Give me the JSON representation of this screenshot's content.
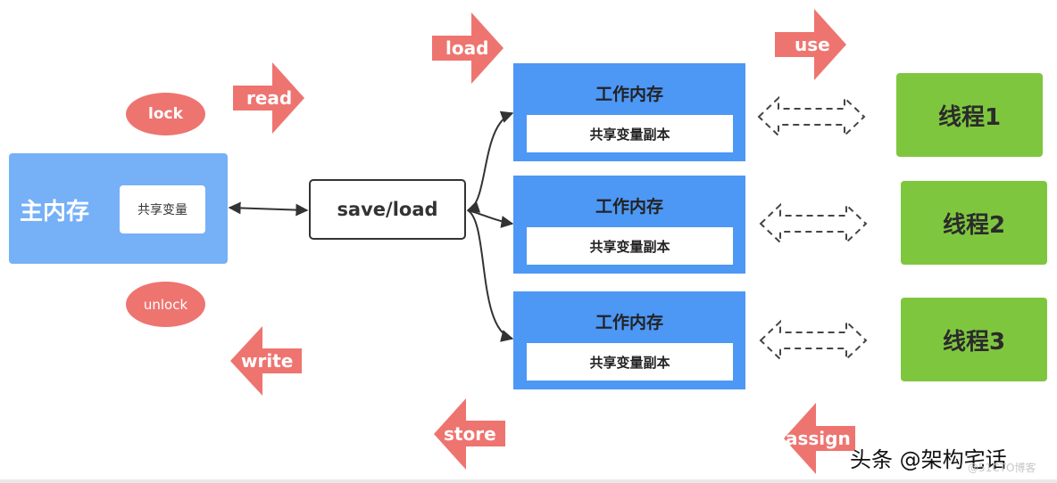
{
  "main_memory": {
    "label": "主内存",
    "shared_variable": "共享变量"
  },
  "operations": {
    "lock": "lock",
    "unlock": "unlock",
    "read": "read",
    "load": "load",
    "use": "use",
    "write": "write",
    "store": "store",
    "assign": "assign"
  },
  "save_load": "save/load",
  "working_memories": [
    {
      "title": "工作内存",
      "copy": "共享变量副本"
    },
    {
      "title": "工作内存",
      "copy": "共享变量副本"
    },
    {
      "title": "工作内存",
      "copy": "共享变量副本"
    }
  ],
  "threads": [
    {
      "label": "线程1"
    },
    {
      "label": "线程2"
    },
    {
      "label": "线程3"
    }
  ],
  "watermark": {
    "main": "头条 @架构宅话",
    "sub": "@51CTO博客"
  },
  "colors": {
    "main_memory": "#76b0f7",
    "working_memory": "#4d97f5",
    "thread": "#7fc63f",
    "operation": "#ee7470",
    "connector": "#333333"
  }
}
